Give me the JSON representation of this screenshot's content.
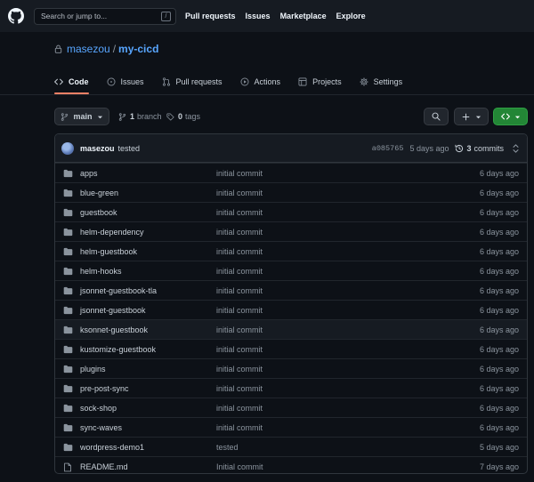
{
  "header": {
    "search_placeholder": "Search or jump to...",
    "search_shortcut": "/",
    "nav": [
      "Pull requests",
      "Issues",
      "Marketplace",
      "Explore"
    ]
  },
  "repo": {
    "owner": "masezou",
    "separator": "/",
    "name": "my-cicd"
  },
  "tabs": [
    {
      "label": "Code",
      "icon": "code-icon",
      "active": true
    },
    {
      "label": "Issues",
      "icon": "issue-icon"
    },
    {
      "label": "Pull requests",
      "icon": "pull-request-icon"
    },
    {
      "label": "Actions",
      "icon": "play-icon"
    },
    {
      "label": "Projects",
      "icon": "table-icon"
    },
    {
      "label": "Settings",
      "icon": "gear-icon"
    }
  ],
  "toolbar": {
    "branch": "main",
    "branch_count": "1",
    "branch_label": "branch",
    "tag_count": "0",
    "tag_label": "tags"
  },
  "latest_commit": {
    "author": "masezou",
    "message": "tested",
    "sha": "a085765",
    "age": "5 days ago",
    "commit_count": "3",
    "commit_label": "commits"
  },
  "files": [
    {
      "type": "dir",
      "name": "apps",
      "message": "initial commit",
      "age": "6 days ago"
    },
    {
      "type": "dir",
      "name": "blue-green",
      "message": "initial commit",
      "age": "6 days ago"
    },
    {
      "type": "dir",
      "name": "guestbook",
      "message": "initial commit",
      "age": "6 days ago"
    },
    {
      "type": "dir",
      "name": "helm-dependency",
      "message": "initial commit",
      "age": "6 days ago"
    },
    {
      "type": "dir",
      "name": "helm-guestbook",
      "message": "initial commit",
      "age": "6 days ago"
    },
    {
      "type": "dir",
      "name": "helm-hooks",
      "message": "initial commit",
      "age": "6 days ago"
    },
    {
      "type": "dir",
      "name": "jsonnet-guestbook-tla",
      "message": "initial commit",
      "age": "6 days ago"
    },
    {
      "type": "dir",
      "name": "jsonnet-guestbook",
      "message": "initial commit",
      "age": "6 days ago"
    },
    {
      "type": "dir",
      "name": "ksonnet-guestbook",
      "message": "initial commit",
      "age": "6 days ago"
    },
    {
      "type": "dir",
      "name": "kustomize-guestbook",
      "message": "initial commit",
      "age": "6 days ago"
    },
    {
      "type": "dir",
      "name": "plugins",
      "message": "initial commit",
      "age": "6 days ago"
    },
    {
      "type": "dir",
      "name": "pre-post-sync",
      "message": "initial commit",
      "age": "6 days ago"
    },
    {
      "type": "dir",
      "name": "sock-shop",
      "message": "initial commit",
      "age": "6 days ago"
    },
    {
      "type": "dir",
      "name": "sync-waves",
      "message": "initial commit",
      "age": "6 days ago"
    },
    {
      "type": "dir",
      "name": "wordpress-demo1",
      "message": "tested",
      "age": "5 days ago"
    },
    {
      "type": "file",
      "name": "README.md",
      "message": "Initial commit",
      "age": "7 days ago"
    }
  ]
}
